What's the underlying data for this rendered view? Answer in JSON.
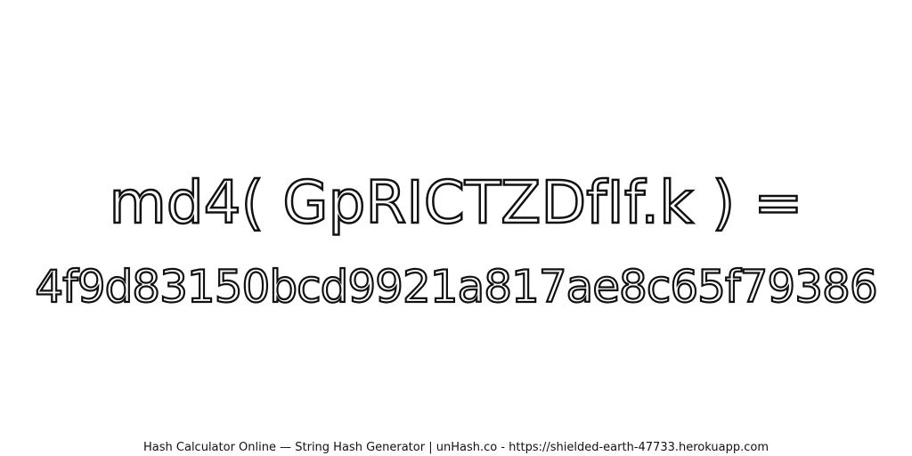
{
  "expression": "md4( GpRICTZDfIf.k ) =",
  "hash": "4f9d83150bcd9921a817ae8c65f79386",
  "footer": "Hash Calculator Online — String Hash Generator | unHash.co - https://shielded-earth-47733.herokuapp.com",
  "colors": {
    "background": "#ffffff",
    "outline": "#111111",
    "fill": "#ffffff"
  }
}
